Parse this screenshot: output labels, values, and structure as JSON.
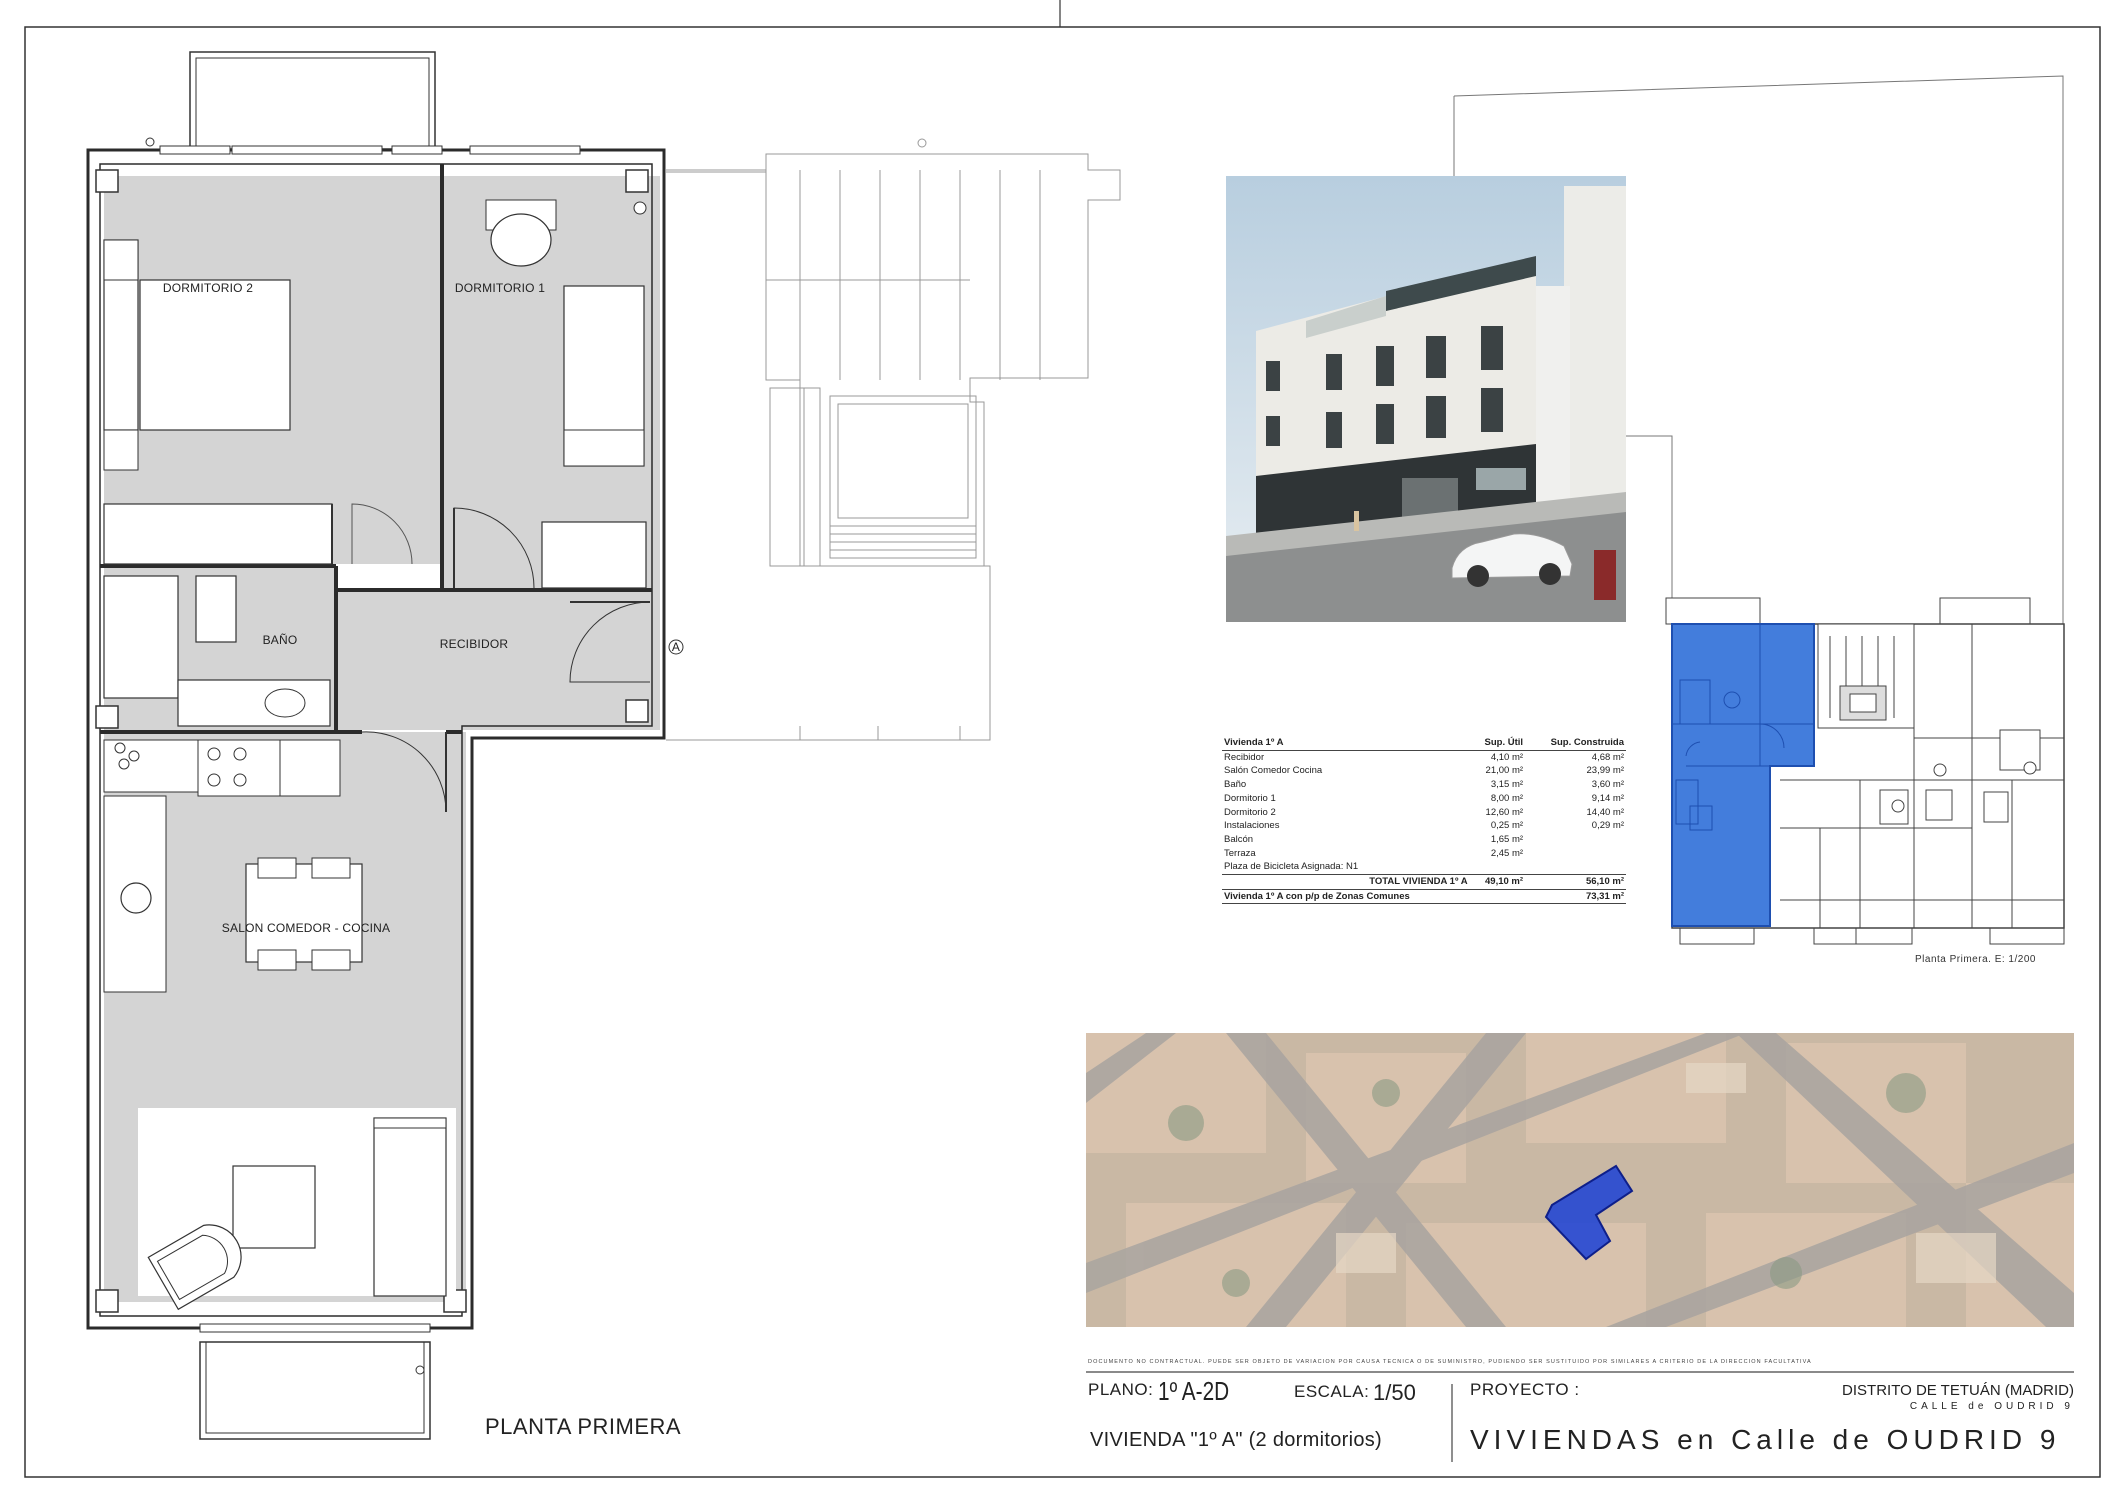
{
  "rooms": {
    "dormitorio_2": "DORMITORIO 2",
    "dormitorio_1": "DORMITORIO 1",
    "bano": "BAÑO",
    "recibidor": "RECIBIDOR",
    "salon": "SALON COMEDOR - COCINA"
  },
  "entry_marker": "A",
  "plan_title": "PLANTA PRIMERA",
  "area_table": {
    "header": [
      "Vivienda 1º A",
      "Sup. Útil",
      "Sup. Construida"
    ],
    "rows": [
      [
        "Recibidor",
        "4,10 m²",
        "4,68 m²"
      ],
      [
        "Salón Comedor Cocina",
        "21,00 m²",
        "23,99 m²"
      ],
      [
        "Baño",
        "3,15 m²",
        "3,60 m²"
      ],
      [
        "Dormitorio 1",
        "8,00 m²",
        "9,14 m²"
      ],
      [
        "Dormitorio 2",
        "12,60 m²",
        "14,40 m²"
      ],
      [
        "Instalaciones",
        "0,25 m²",
        "0,29 m²"
      ],
      [
        "Balcón",
        "1,65 m²",
        ""
      ],
      [
        "Terraza",
        "2,45 m²",
        ""
      ],
      [
        "Plaza de Bicicleta Asignada: N1",
        "",
        ""
      ]
    ],
    "total": [
      "TOTAL VIVIENDA 1º A",
      "49,10 m²",
      "56,10 m²"
    ],
    "grand_total": [
      "Vivienda 1º A con p/p de Zonas Comunes",
      "",
      "73,31 m²"
    ]
  },
  "keyplan_caption": "Planta Primera. E: 1/200",
  "disclaimer": "DOCUMENTO NO CONTRACTUAL. PUEDE SER OBJETO DE VARIACIÓN POR CAUSA TÉCNICA O DE SUMINISTRO, PUDIENDO SER SUSTITUIDO POR SIMILARES A CRITERIO DE LA DIRECCIÓN FACULTATIVA",
  "title_block": {
    "plano_label": "PLANO:",
    "plano_value": "1º A-2D",
    "escala_label": "ESCALA:",
    "escala_value": "1/50",
    "proyecto_label": "PROYECTO :",
    "distrito": "DISTRITO DE TETUÁN (MADRID)",
    "calle_small": "CALLE de OUDRID 9",
    "vivienda": "VIVIENDA \"1º A\" (2 dormitorios)",
    "project_name": "VIVIENDAS en Calle de OUDRID 9"
  },
  "colors": {
    "room_fill": "#d4d4d4",
    "wall": "#2b2b2b",
    "highlight_blue": "#2f6fd8",
    "aerial_blue": "#1a3fd6"
  }
}
